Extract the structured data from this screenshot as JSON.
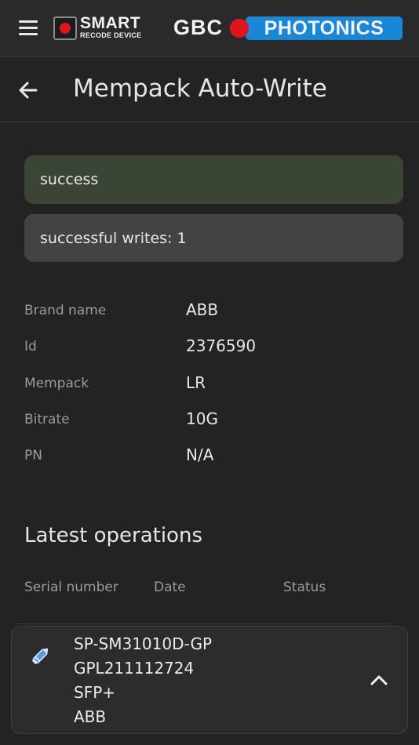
{
  "topbar": {
    "menu_icon": "hamburger-menu-icon",
    "smart_logo": {
      "line1": "SMART",
      "line2": "RECODE DEVICE"
    },
    "gbc_logo": {
      "left": "GBC",
      "right": "PHOTONICS"
    }
  },
  "header": {
    "back_icon": "arrow-left-icon",
    "title": "Mempack Auto-Write"
  },
  "alerts": {
    "success": "success",
    "writes": "successful writes: 1"
  },
  "info": [
    {
      "label": "Brand name",
      "value": "ABB"
    },
    {
      "label": "Id",
      "value": "2376590"
    },
    {
      "label": "Mempack",
      "value": "LR"
    },
    {
      "label": "Bitrate",
      "value": "10G"
    },
    {
      "label": "PN",
      "value": "N/A"
    }
  ],
  "operations": {
    "title": "Latest operations",
    "columns": [
      "Serial number",
      "Date",
      "Status"
    ],
    "rows": [
      {
        "icon": "pencil-icon",
        "lines": [
          "SP-SM31010D-GP",
          "GPL211112724",
          "SFP+",
          "ABB"
        ],
        "expand_icon": "chevron-up-icon"
      }
    ]
  },
  "colors": {
    "background": "#232323",
    "topbar": "#2a2a2a",
    "success_alert": "#3a4535",
    "info_alert": "#434343",
    "brand_red": "#e0141e",
    "brand_blue": "#1a86d6",
    "pencil_blue": "#5b9ae8"
  }
}
